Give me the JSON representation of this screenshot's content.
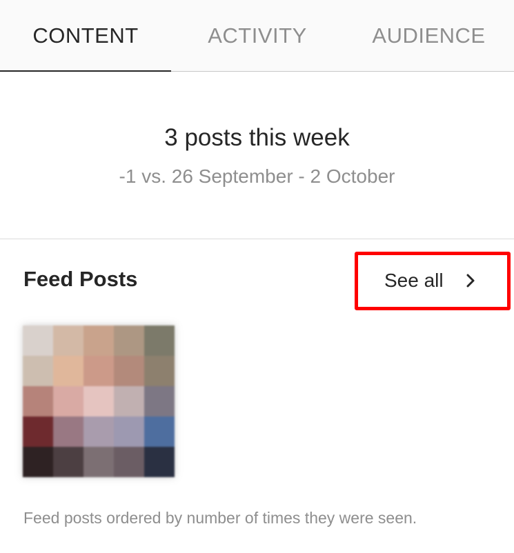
{
  "tabs": {
    "content": "CONTENT",
    "activity": "ACTIVITY",
    "audience": "AUDIENCE"
  },
  "summary": {
    "title": "3 posts this week",
    "comparison": "-1 vs. 26 September - 2 October"
  },
  "feed_posts": {
    "title": "Feed Posts",
    "see_all_label": "See all",
    "see_all_icon": "chevron-right-icon",
    "thumbnail_colors": [
      "#d9d1cc",
      "#d3b9a6",
      "#c9a38c",
      "#ad9783",
      "#7c7a6a",
      "#cdbeb0",
      "#e0b79b",
      "#cc9a89",
      "#b38a7b",
      "#8d806e",
      "#b6837a",
      "#d9aaa4",
      "#e5c4c0",
      "#c1b0b1",
      "#7d7784",
      "#6e2a2e",
      "#997883",
      "#a99cad",
      "#9d99b1",
      "#4e6e9f",
      "#2e2223",
      "#4c3f42",
      "#7c6f73",
      "#6b5d64",
      "#2a3042"
    ],
    "footnote": "Feed posts ordered by number of times they were seen."
  },
  "colors": {
    "highlight": "#ff0000",
    "text_primary": "#262626",
    "text_secondary": "#8e8e8e"
  }
}
